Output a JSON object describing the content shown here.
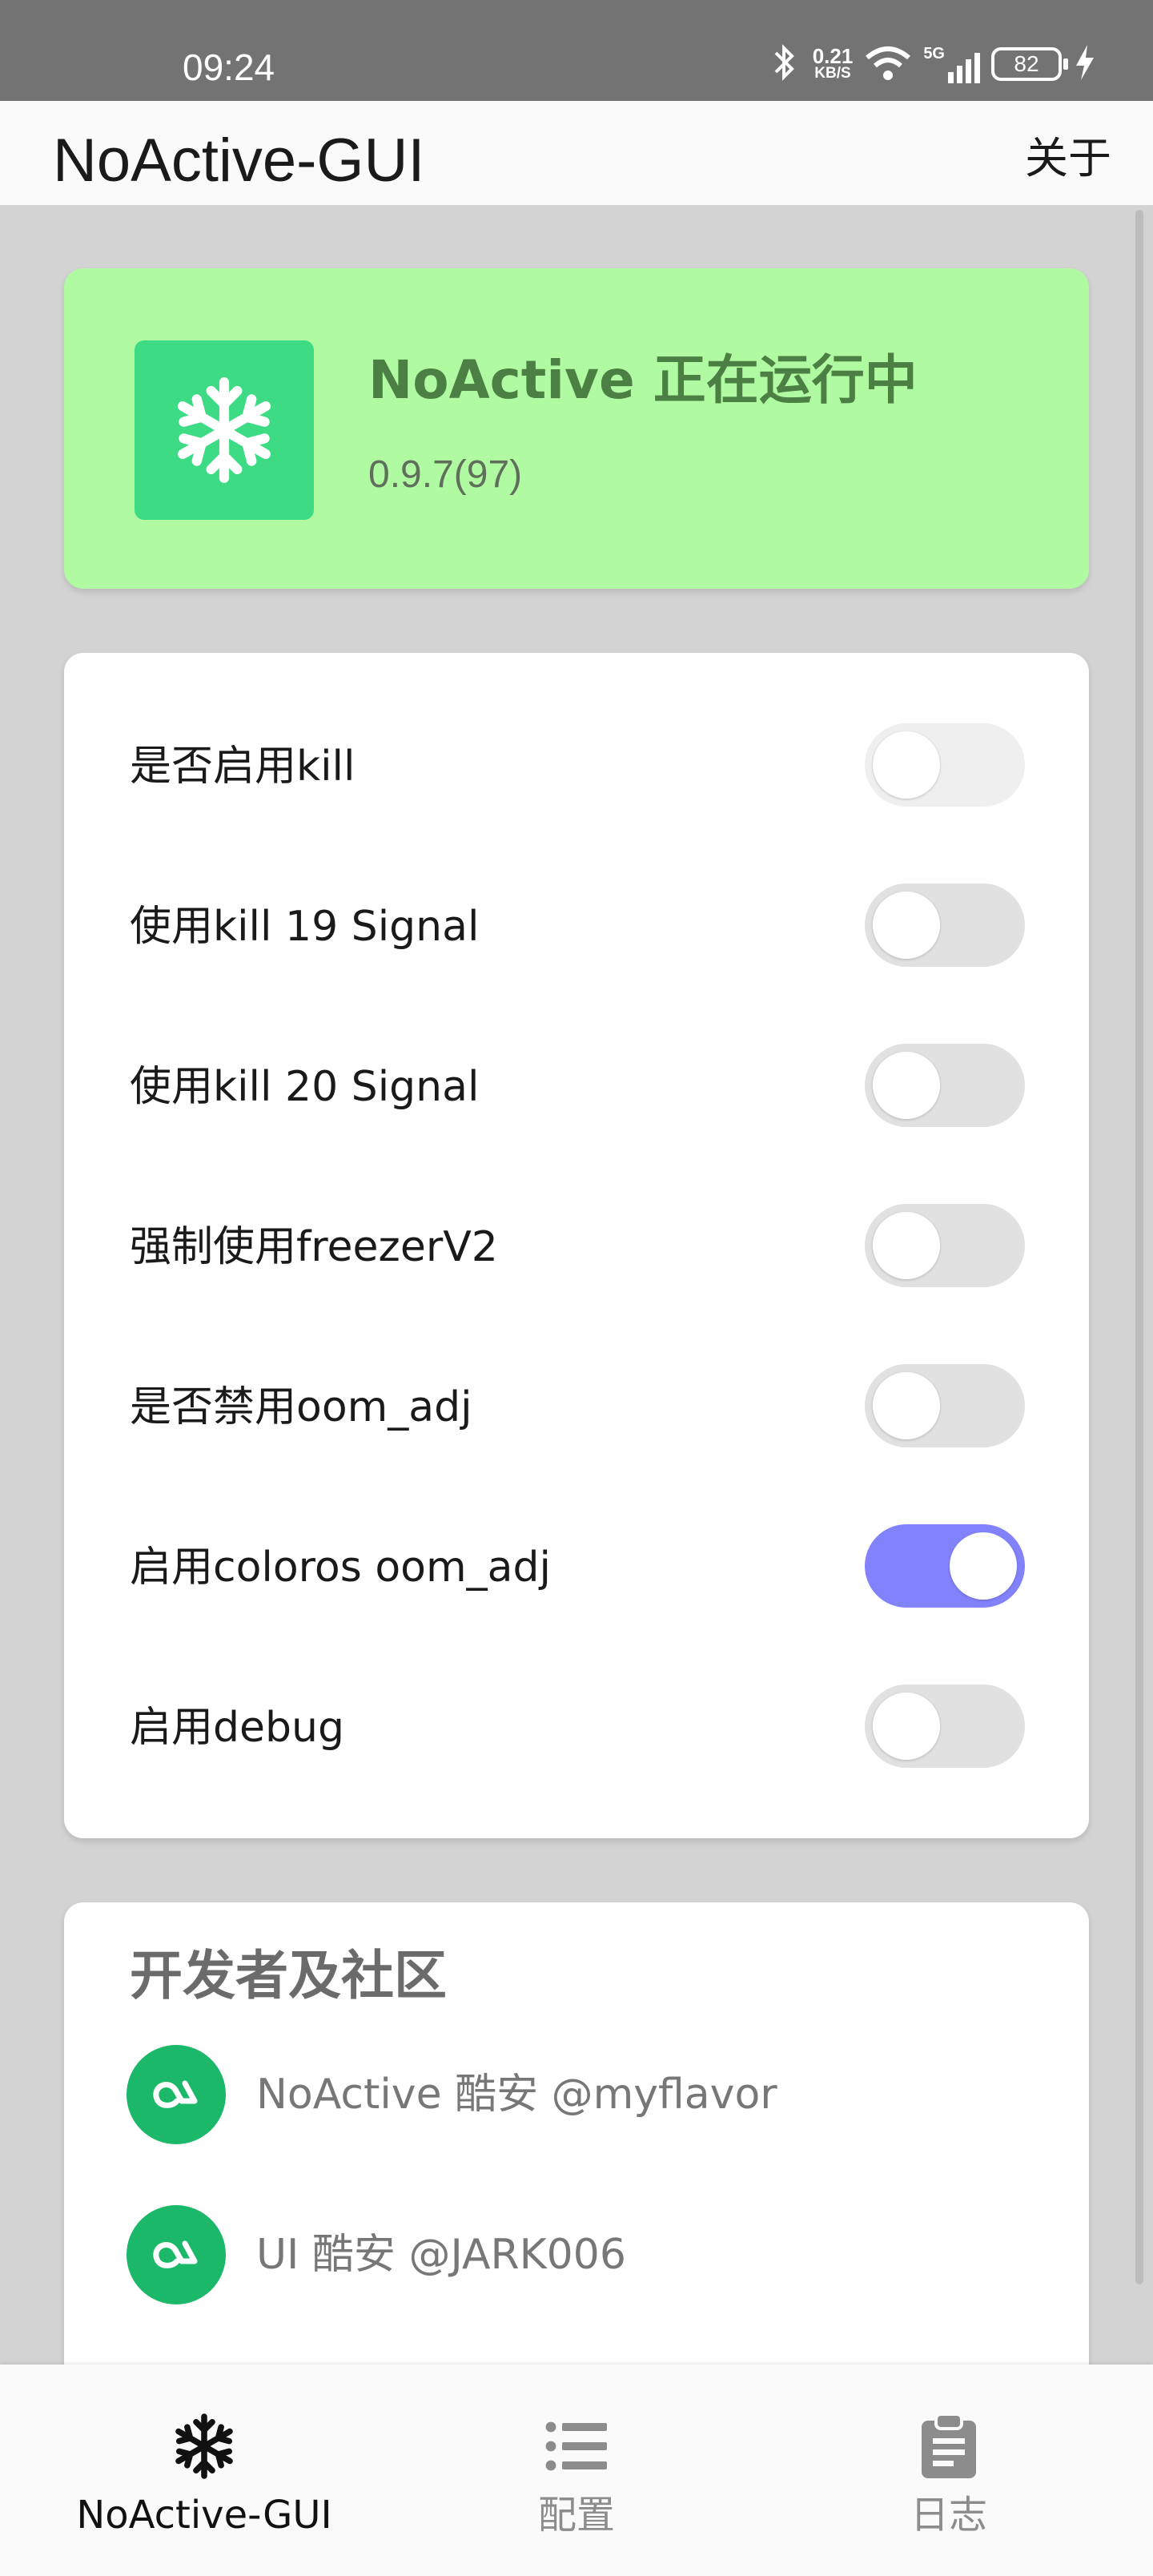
{
  "status_bar": {
    "time": "09:24",
    "net_speed_value": "0.21",
    "net_speed_unit": "KB/S",
    "network_type": "5G",
    "battery_level": "82",
    "icons": [
      "bluetooth-icon",
      "wifi-icon",
      "cellular-signal-icon",
      "battery-icon",
      "charging-icon"
    ]
  },
  "app_bar": {
    "title": "NoActive-GUI",
    "about_label": "关于"
  },
  "status_card": {
    "title": "NoActive 正在运行中",
    "version": "0.9.7(97)",
    "icon": "snowflake-icon",
    "background_color": "#b0fba1"
  },
  "settings": {
    "items": [
      {
        "label": "是否启用kill",
        "state": "off-disabled"
      },
      {
        "label": "使用kill 19 Signal",
        "state": "off"
      },
      {
        "label": "使用kill 20 Signal",
        "state": "off"
      },
      {
        "label": "强制使用freezerV2",
        "state": "off"
      },
      {
        "label": "是否禁用oom_adj",
        "state": "off"
      },
      {
        "label": "启用coloros oom_adj",
        "state": "on"
      },
      {
        "label": "启用debug",
        "state": "off"
      }
    ],
    "accent_color": "#8282fd"
  },
  "developers": {
    "title": "开发者及社区",
    "items": [
      {
        "text": "NoActive 酷安 @myflavor",
        "icon": "coolapk-icon"
      },
      {
        "text": "UI 酷安 @JARK006",
        "icon": "coolapk-icon"
      }
    ]
  },
  "bottom_nav": {
    "items": [
      {
        "label": "NoActive-GUI",
        "icon": "snowflake-icon",
        "active": true
      },
      {
        "label": "配置",
        "icon": "list-icon",
        "active": false
      },
      {
        "label": "日志",
        "icon": "clipboard-icon",
        "active": false
      }
    ]
  }
}
